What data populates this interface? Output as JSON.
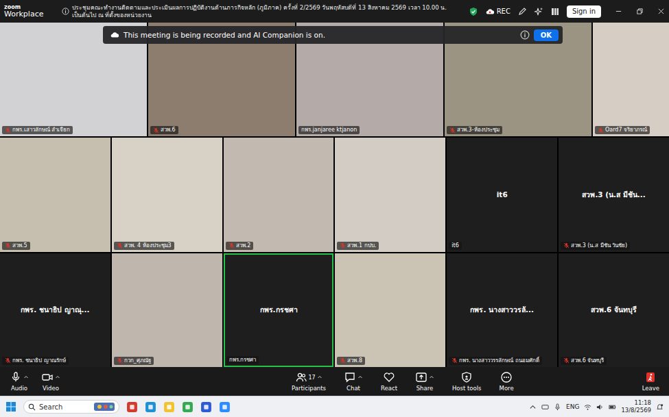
{
  "window": {
    "brand": "zoom",
    "product": "Workplace",
    "title": "ประชุมคณะทำงานติดตามและประเมินผลการปฏิบัติงานด้านภารกิจหลัก (ภูมิภาค) ครั้งที่ 2/2569 วันพฤหัสบดีที่ 13 สิงหาคม 2569 เวลา 10.00 น. เป็นต้นไป ณ ที่ตั้งของหน่วยงาน",
    "recording": "REC",
    "sign_in": "Sign in"
  },
  "banner": {
    "text": "This meeting is being recorded and AI Companion is on.",
    "button": "OK"
  },
  "rows": [
    [
      {
        "name": "กพร.เสาวลักษณ์ ลำเจียก",
        "kind": "video",
        "muted": true,
        "speaking": false,
        "color": "#d2d2d4"
      },
      {
        "name": "สวพ.6",
        "kind": "video",
        "muted": true,
        "speaking": false,
        "color": "#8c7d6e"
      },
      {
        "name": "กพร.janjaree ktjanon",
        "kind": "video",
        "muted": false,
        "speaking": false,
        "color": "#b4aaa8"
      },
      {
        "name": "สวพ.3-ห้องประชุม",
        "kind": "video",
        "muted": true,
        "speaking": false,
        "color": "#9c9482"
      },
      {
        "name": "Oard7 จริยาภรณ์",
        "kind": "video",
        "muted": true,
        "speaking": false,
        "color": "#d6cdc4"
      }
    ],
    [
      {
        "name": "สวพ.5",
        "kind": "video",
        "muted": true,
        "speaking": false,
        "color": "#c6bfb0"
      },
      {
        "name": "สวพ. 4 ห้องประชุม3",
        "kind": "video",
        "muted": true,
        "speaking": false,
        "color": "#d8d2c6"
      },
      {
        "name": "สวพ.2",
        "kind": "video",
        "muted": true,
        "speaking": false,
        "color": "#c2bab0"
      },
      {
        "name": "สวพ.1 กปบ.",
        "kind": "video",
        "muted": true,
        "speaking": false,
        "color": "#d2ccc4"
      },
      {
        "name": "it6",
        "kind": "off",
        "muted": false,
        "speaking": false,
        "display": "it6"
      },
      {
        "name": "สวพ.3 (น.ส มีชัน วันชัย)",
        "kind": "off",
        "muted": true,
        "speaking": false,
        "display": "สวพ.3 (น.ส มีชัน..."
      }
    ],
    [
      {
        "name": "กพร. ชนาธิป ญาณรักษ์",
        "kind": "off",
        "muted": true,
        "speaking": false,
        "display": "กพร. ชนาธิป ญาณุ..."
      },
      {
        "name": "กวก_ศุภณัฐ",
        "kind": "video",
        "muted": true,
        "speaking": false,
        "color": "#bfb6ae"
      },
      {
        "name": "กพร.กรชศา",
        "kind": "off",
        "muted": false,
        "speaking": true,
        "display": "กพร.กรชศา"
      },
      {
        "name": "สวพ.8",
        "kind": "video",
        "muted": true,
        "speaking": false,
        "color": "#cbc3b4"
      },
      {
        "name": "กพร. นางสาววรรลักษณ์ ถนอมศักดิ์",
        "kind": "off",
        "muted": true,
        "speaking": false,
        "display": "กพร. นางสาววรลั..."
      },
      {
        "name": "สวพ.6 จันทบุรี",
        "kind": "off",
        "muted": true,
        "speaking": false,
        "display": "สวพ.6 จันทบุรี"
      }
    ]
  ],
  "toolbar": {
    "left": [
      {
        "label": "Audio",
        "caret": true
      },
      {
        "label": "Video",
        "caret": true
      }
    ],
    "center": [
      {
        "label": "Participants",
        "badge": "17",
        "caret": true
      },
      {
        "label": "Chat",
        "caret": true
      },
      {
        "label": "React",
        "caret": false
      },
      {
        "label": "Share",
        "caret": true
      },
      {
        "label": "Host tools",
        "caret": false
      },
      {
        "label": "More",
        "caret": false
      }
    ],
    "leave": "Leave"
  },
  "taskbar": {
    "search": "Search",
    "language": "ENG",
    "time": "11:18",
    "date": "13/8/2569"
  }
}
